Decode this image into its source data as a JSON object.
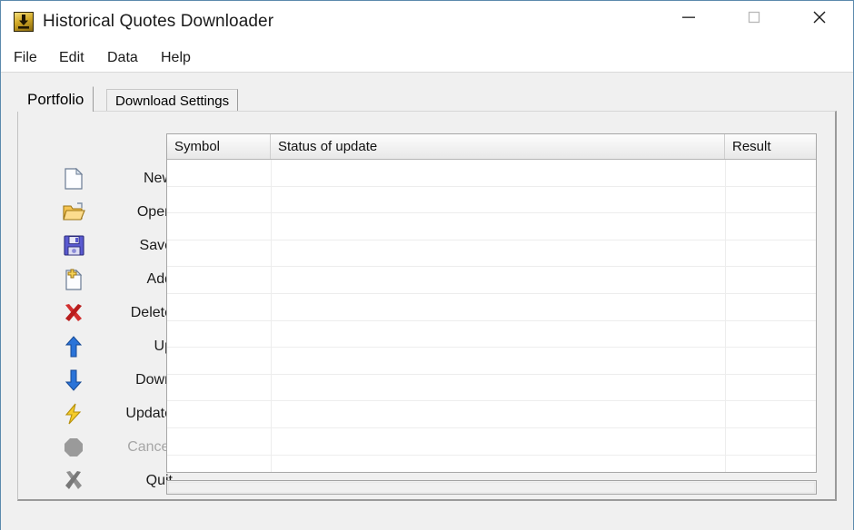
{
  "window": {
    "title": "Historical Quotes Downloader",
    "icon": "download-app-icon",
    "controls": {
      "minimize": "minimize-icon",
      "maximize": "maximize-icon",
      "close": "close-icon"
    }
  },
  "menubar": {
    "items": [
      {
        "label": "File"
      },
      {
        "label": "Edit"
      },
      {
        "label": "Data"
      },
      {
        "label": "Help"
      }
    ]
  },
  "tabs": [
    {
      "label": "Portfolio",
      "active": true
    },
    {
      "label": "Download Settings",
      "active": false
    }
  ],
  "sidebar": {
    "items": [
      {
        "label": "New",
        "icon": "new-file-icon",
        "enabled": true
      },
      {
        "label": "Open",
        "icon": "open-folder-icon",
        "enabled": true
      },
      {
        "label": "Save",
        "icon": "save-disk-icon",
        "enabled": true
      },
      {
        "label": "Add",
        "icon": "add-file-icon",
        "enabled": true
      },
      {
        "label": "Delete",
        "icon": "delete-x-icon",
        "enabled": true
      },
      {
        "label": "Up",
        "icon": "arrow-up-icon",
        "enabled": true
      },
      {
        "label": "Down",
        "icon": "arrow-down-icon",
        "enabled": true
      },
      {
        "label": "Update",
        "icon": "lightning-bolt-icon",
        "enabled": true
      },
      {
        "label": "Cancel",
        "icon": "stop-octagon-icon",
        "enabled": false
      },
      {
        "label": "Quit",
        "icon": "quit-x-icon",
        "enabled": true
      }
    ]
  },
  "listview": {
    "columns": [
      {
        "label": "Symbol"
      },
      {
        "label": "Status of update"
      },
      {
        "label": "Result"
      }
    ],
    "rows": [],
    "empty_row_count": 12
  },
  "statusbar": {
    "progress_percent": 0,
    "text": ""
  },
  "colors": {
    "window_border": "#5c8aad",
    "panel_background": "#f0f0f0",
    "list_background": "#ffffff",
    "icon_gold": "#e0b321",
    "icon_blue": "#2a6fd4",
    "icon_red": "#cc2222",
    "icon_gray": "#8c8c8c",
    "disabled_text": "#a6a6a6"
  }
}
